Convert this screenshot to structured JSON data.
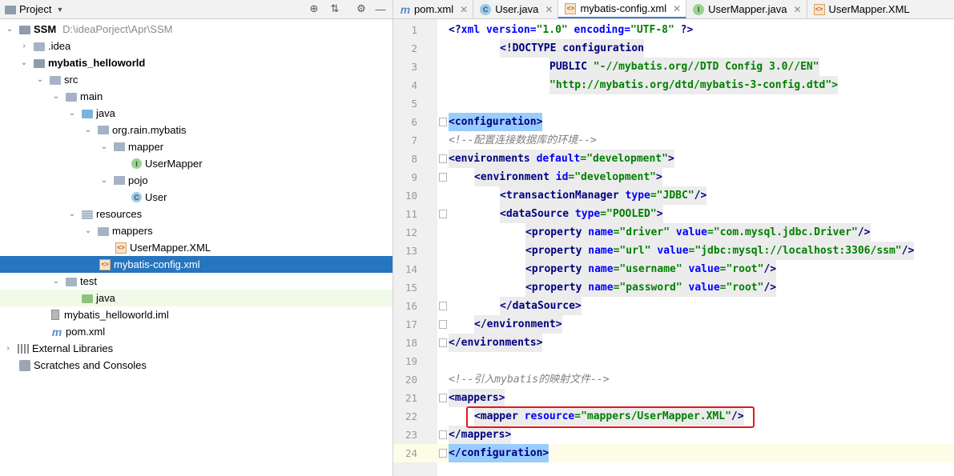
{
  "project_panel": {
    "title": "Project",
    "tree": [
      {
        "label": "SSM",
        "path": "D:\\ideaPorject\\Apr\\SSM",
        "bold": true
      },
      {
        "label": ".idea"
      },
      {
        "label": "mybatis_helloworld",
        "bold": true
      },
      {
        "label": "src"
      },
      {
        "label": "main"
      },
      {
        "label": "java"
      },
      {
        "label": "org.rain.mybatis"
      },
      {
        "label": "mapper"
      },
      {
        "label": "UserMapper"
      },
      {
        "label": "pojo"
      },
      {
        "label": "User"
      },
      {
        "label": "resources"
      },
      {
        "label": "mappers"
      },
      {
        "label": "UserMapper.XML"
      },
      {
        "label": "mybatis-config.xml",
        "selected": true
      },
      {
        "label": "test"
      },
      {
        "label": "java"
      },
      {
        "label": "mybatis_helloworld.iml"
      },
      {
        "label": "pom.xml"
      },
      {
        "label": "External Libraries"
      },
      {
        "label": "Scratches and Consoles"
      }
    ]
  },
  "tabs": [
    {
      "label": "pom.xml",
      "icon": "maven-icon"
    },
    {
      "label": "User.java",
      "icon": "class-icon"
    },
    {
      "label": "mybatis-config.xml",
      "icon": "xml-icon",
      "active": true
    },
    {
      "label": "UserMapper.java",
      "icon": "interface-icon"
    },
    {
      "label": "UserMapper.XML",
      "icon": "xml-icon"
    }
  ],
  "editor": {
    "line_numbers": [
      "1",
      "2",
      "3",
      "4",
      "5",
      "6",
      "7",
      "8",
      "9",
      "10",
      "11",
      "12",
      "13",
      "14",
      "15",
      "16",
      "17",
      "18",
      "19",
      "20",
      "21",
      "22",
      "23",
      "24"
    ],
    "lines": {
      "l1_a": "<?",
      "l1_b": "xml ",
      "l1_c": "version",
      "l1_d": "=",
      "l1_e": "\"1.0\"",
      "l1_f": " encoding",
      "l1_g": "=",
      "l1_h": "\"UTF-8\"",
      "l1_i": " ?>",
      "l2": "<!DOCTYPE configuration",
      "l3_a": "PUBLIC ",
      "l3_b": "\"-//mybatis.org//DTD Config 3.0//EN\"",
      "l4": "\"http://mybatis.org/dtd/mybatis-3-config.dtd\">",
      "l6": "<configuration>",
      "l7": "<!--配置连接数据库的环境-->",
      "l8_a": "<environments ",
      "l8_b": "default",
      "l8_c": "=\"development\"",
      "l8_d": ">",
      "l9_a": "<environment ",
      "l9_b": "id",
      "l9_c": "=\"development\"",
      "l9_d": ">",
      "l10_a": "<transactionManager ",
      "l10_b": "type",
      "l10_c": "=\"JDBC\"",
      "l10_d": "/>",
      "l11_a": "<dataSource ",
      "l11_b": "type",
      "l11_c": "=\"POOLED\"",
      "l11_d": ">",
      "l12_a": "<property ",
      "l12_b": "name",
      "l12_c": "=\"driver\"",
      "l12_d": " value",
      "l12_e": "=\"com.mysql.jdbc.Driver\"",
      "l12_f": "/>",
      "l13_a": "<property ",
      "l13_b": "name",
      "l13_c": "=\"url\"",
      "l13_d": " value",
      "l13_e": "=\"jdbc:mysql://localhost:3306/ssm\"",
      "l13_f": "/>",
      "l14_a": "<property ",
      "l14_b": "name",
      "l14_c": "=\"username\"",
      "l14_d": " value",
      "l14_e": "=\"root\"",
      "l14_f": "/>",
      "l15_a": "<property ",
      "l15_b": "name",
      "l15_c": "=\"password\"",
      "l15_d": " value",
      "l15_e": "=\"root\"",
      "l15_f": "/>",
      "l16": "</dataSource>",
      "l17": "</environment>",
      "l18": "</environments>",
      "l20": "<!--引入mybatis的映射文件-->",
      "l21": "<mappers>",
      "l22_a": "<mapper ",
      "l22_b": "resource",
      "l22_c": "=\"mappers/UserMapper.XML\"",
      "l22_d": "/>",
      "l23": "</mappers>",
      "l24": "</configuration>"
    }
  },
  "colors": {
    "selection": "#2675bf",
    "annotation_box": "#e01b1b",
    "tag": "#000080",
    "attribute": "#0000ff",
    "value": "#008000"
  }
}
